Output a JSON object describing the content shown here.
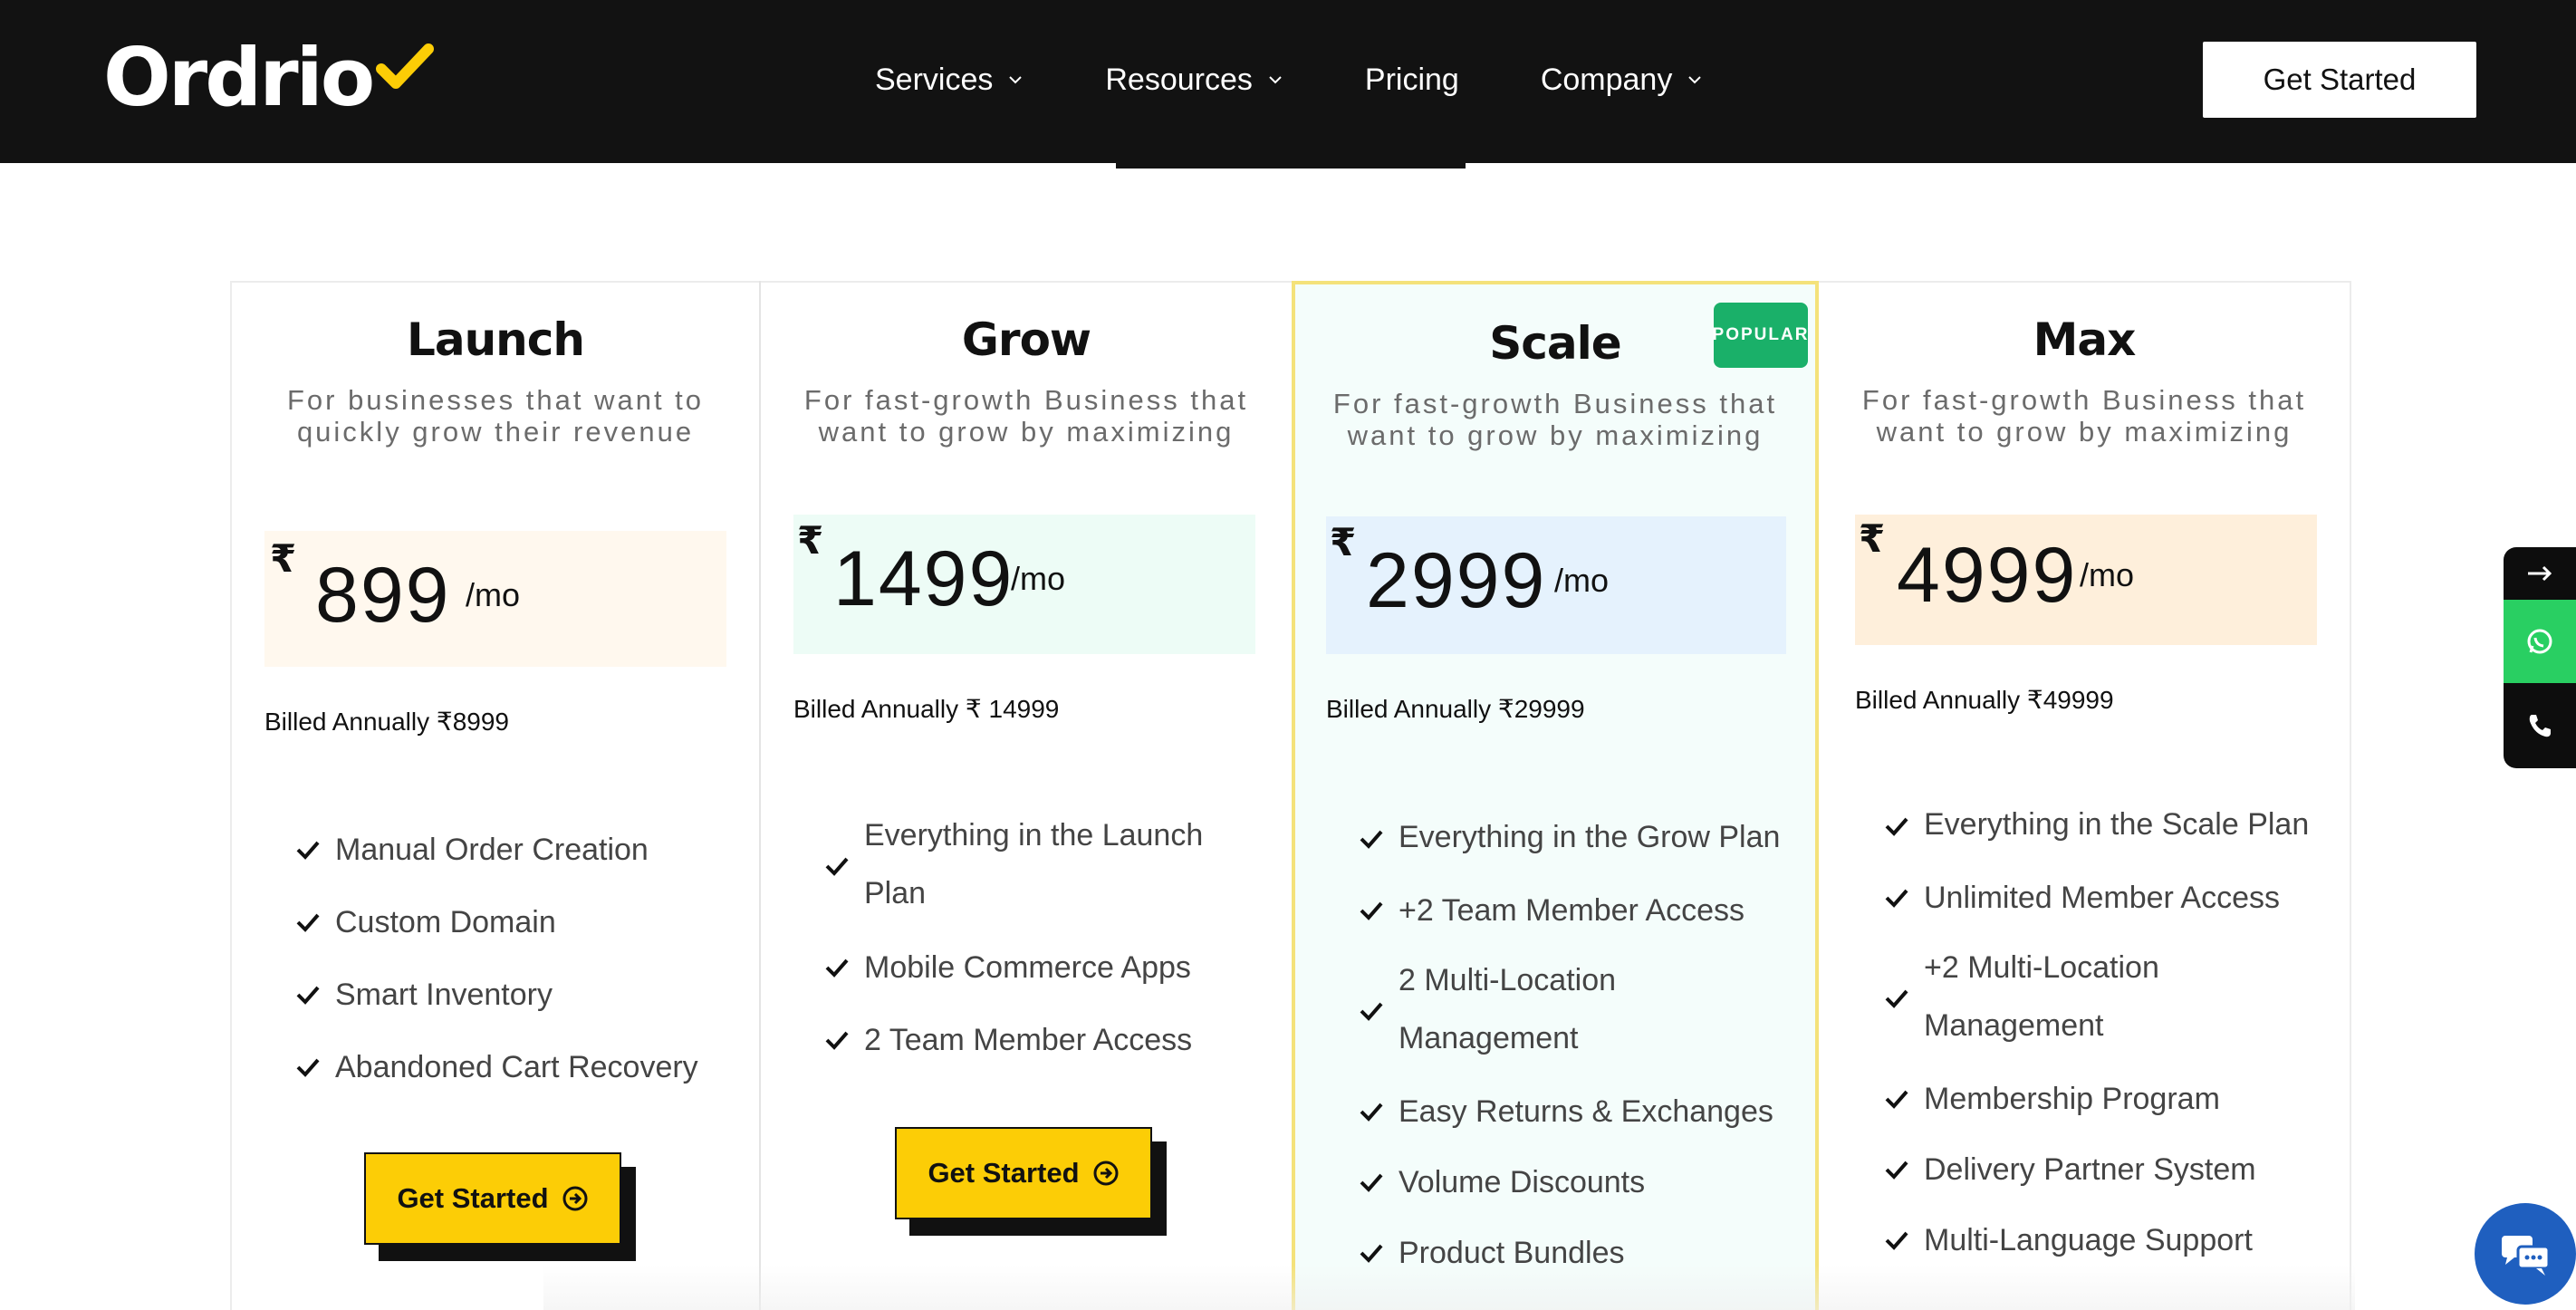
{
  "header": {
    "logo_text": "Ordrio",
    "nav": [
      {
        "label": "Services"
      },
      {
        "label": "Resources"
      },
      {
        "label": "Pricing"
      },
      {
        "label": "Company"
      }
    ],
    "cta_label": "Get Started"
  },
  "plans": [
    {
      "name": "Launch",
      "description": "For businesses that want to quickly grow their revenue",
      "currency": "₹",
      "price": "899",
      "period": "/mo",
      "billed": "Billed Annually ₹8999",
      "price_bg": "#fff8ee",
      "features": [
        "Manual Order Creation",
        "Custom Domain",
        "Smart Inventory",
        "Abandoned Cart Recovery"
      ],
      "button_label": "Get Started"
    },
    {
      "name": "Grow",
      "description": "For fast-growth Business that want to grow by maximizing",
      "currency": "₹",
      "price": "1499",
      "period": "/mo",
      "billed": "Billed Annually ₹ 14999",
      "price_bg": "#edfcf6",
      "features": [
        "Everything in the Launch Plan",
        "Mobile Commerce Apps",
        "2 Team Member Access"
      ],
      "button_label": "Get Started"
    },
    {
      "name": "Scale",
      "badge": "POPULAR",
      "description": "For fast-growth Business that want to grow by maximizing",
      "currency": "₹",
      "price": "2999",
      "period": "/mo",
      "billed": "Billed Annually ₹29999",
      "price_bg": "#e5f2fd",
      "features": [
        "Everything in the Grow Plan",
        "+2 Team Member Access",
        "2 Multi-Location Management",
        "Easy Returns & Exchanges",
        "Volume Discounts",
        "Product Bundles"
      ]
    },
    {
      "name": "Max",
      "description": "For fast-growth Business that want to grow by maximizing",
      "currency": "₹",
      "price": "4999",
      "period": "/mo",
      "billed": "Billed Annually ₹49999",
      "price_bg": "#feefdb",
      "features": [
        "Everything in the Scale Plan",
        "Unlimited Member Access",
        "+2 Multi-Location Management",
        "Membership Program",
        "Delivery Partner System",
        "Multi-Language Support"
      ]
    }
  ],
  "colors": {
    "accent_yellow": "#fccd06",
    "popular_green": "#1ab069",
    "whatsapp_green": "#29cf62",
    "chat_blue": "#1f5fbf",
    "header_bg": "#121212"
  },
  "side_widget": [
    "arrow-right-icon",
    "whatsapp-icon",
    "phone-icon"
  ],
  "chat_widget": "chat-icon"
}
